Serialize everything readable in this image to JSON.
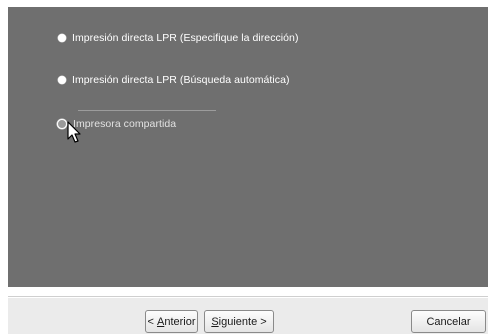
{
  "options": [
    {
      "label": "Impresión directa LPR (Especifique la dirección)",
      "selected": false
    },
    {
      "label": "Impresión directa LPR (Búsqueda automática)",
      "selected": false
    },
    {
      "label": "Impresora compartida",
      "selected": true
    }
  ],
  "buttons": {
    "prev": {
      "prefix": "< ",
      "mnemonic": "A",
      "rest": "nterior"
    },
    "next": {
      "mnemonic": "S",
      "rest": "iguiente >"
    },
    "cancel": "Cancelar"
  },
  "colors": {
    "panel_bg": "#6f6f6f",
    "footer_bg": "#ebebeb",
    "option_text": "#ffffff"
  },
  "icons": {
    "cursor": "arrow-cursor-icon"
  }
}
